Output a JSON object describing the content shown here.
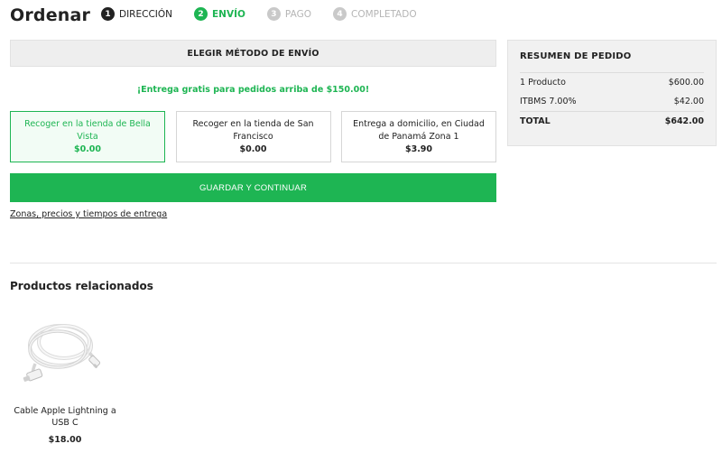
{
  "header": {
    "title": "Ordenar",
    "steps": [
      {
        "num": "1",
        "label": "DIRECCIÓN"
      },
      {
        "num": "2",
        "label": "ENVÍO"
      },
      {
        "num": "3",
        "label": "PAGO"
      },
      {
        "num": "4",
        "label": "COMPLETADO"
      }
    ]
  },
  "shipping": {
    "section_title": "ELEGIR MÉTODO DE ENVÍO",
    "free_note": "¡Entrega gratis para pedidos arriba de $150.00!",
    "options": [
      {
        "label": "Recoger en la tienda de Bella Vista",
        "price": "$0.00"
      },
      {
        "label": "Recoger en la tienda de San Francisco",
        "price": "$0.00"
      },
      {
        "label": "Entrega a domicilio, en Ciudad de Panamá Zona 1",
        "price": "$3.90"
      }
    ],
    "continue_label": "GUARDAR Y CONTINUAR",
    "zones_link": "Zonas, precios y tiempos de entrega"
  },
  "summary": {
    "title": "RESUMEN DE PEDIDO",
    "rows": [
      {
        "label": "1 Producto",
        "value": "$600.00"
      },
      {
        "label": "ITBMS 7.00%",
        "value": "$42.00"
      },
      {
        "label": "TOTAL",
        "value": "$642.00"
      }
    ]
  },
  "related": {
    "title": "Productos relacionados",
    "products": [
      {
        "name": "Cable Apple Lightning a USB C",
        "price": "$18.00",
        "image_icon": "usb-cable-image"
      }
    ]
  },
  "colors": {
    "accent": "#1eb553",
    "dark": "#222222",
    "inactive": "#c9c9c9"
  }
}
